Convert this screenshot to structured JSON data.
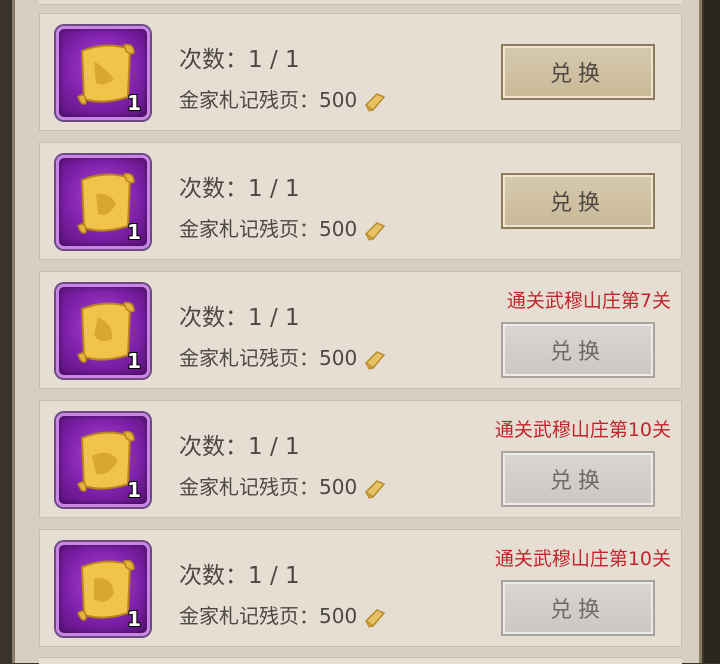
{
  "items": [
    {
      "times_label": "次数：1 / 1",
      "cost_label": "金家札记残页：",
      "cost_value": "500",
      "quantity": "1",
      "requirement": "",
      "button_label": "兑换",
      "enabled": true
    },
    {
      "times_label": "次数：1 / 1",
      "cost_label": "金家札记残页：",
      "cost_value": "500",
      "quantity": "1",
      "requirement": "",
      "button_label": "兑换",
      "enabled": true
    },
    {
      "times_label": "次数：1 / 1",
      "cost_label": "金家札记残页：",
      "cost_value": "500",
      "quantity": "1",
      "requirement": "通关武穆山庄第7关",
      "button_label": "兑换",
      "enabled": false
    },
    {
      "times_label": "次数：1 / 1",
      "cost_label": "金家札记残页：",
      "cost_value": "500",
      "quantity": "1",
      "requirement": "通关武穆山庄第10关",
      "button_label": "兑换",
      "enabled": false
    },
    {
      "times_label": "次数：1 / 1",
      "cost_label": "金家札记残页：",
      "cost_value": "500",
      "quantity": "1",
      "requirement": "通关武穆山庄第10关",
      "button_label": "兑换",
      "enabled": false
    }
  ],
  "icons": {
    "item": "golden-scroll-icon",
    "currency": "scroll-fragment-icon"
  },
  "colors": {
    "requirement_text": "#c0262d",
    "item_frame": "#7b1fa6"
  }
}
